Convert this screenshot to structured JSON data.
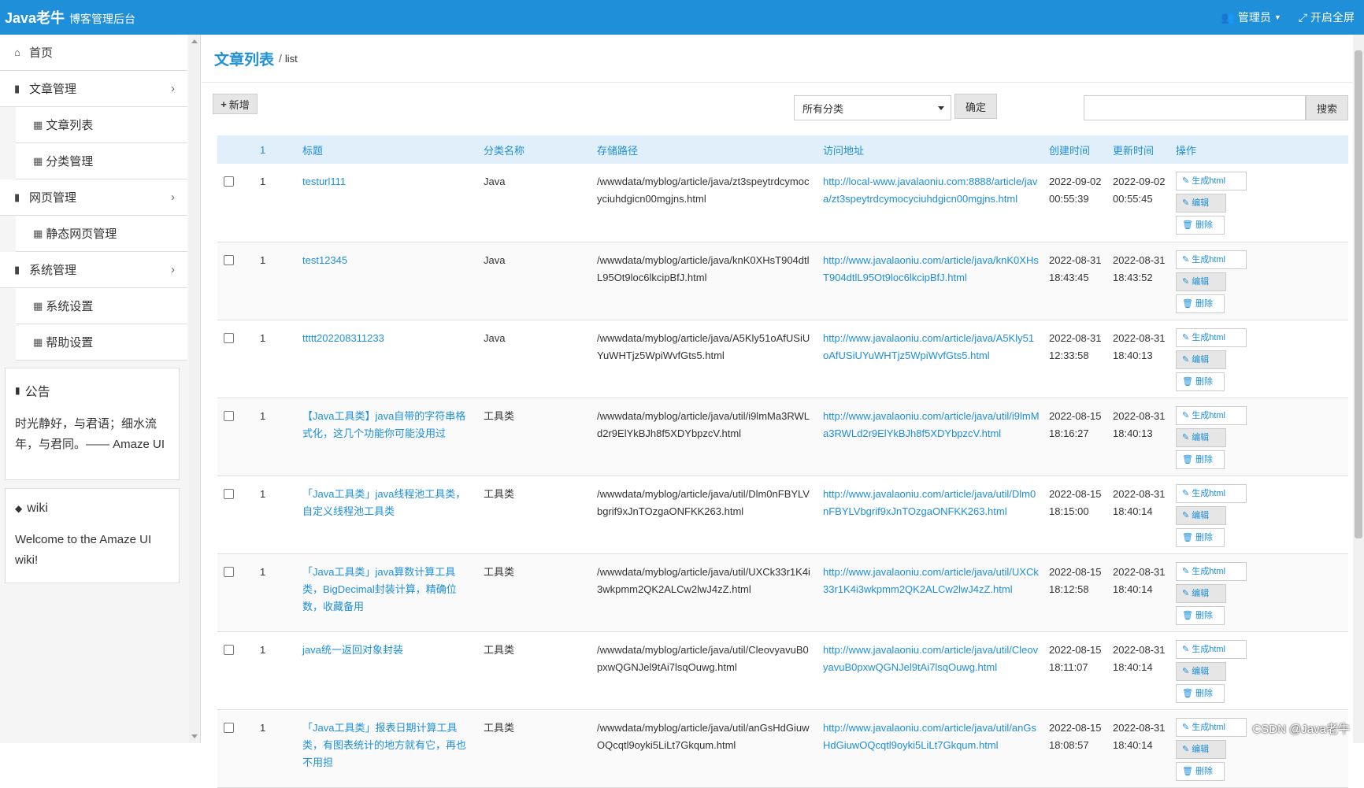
{
  "header": {
    "brand": "Java老牛",
    "subtitle": "博客管理后台",
    "admin_label": "管理员",
    "fullscreen_label": "开启全屏"
  },
  "sidebar": {
    "items": [
      {
        "label": "首页"
      },
      {
        "label": "文章管理",
        "children": [
          {
            "label": "文章列表"
          },
          {
            "label": "分类管理"
          }
        ]
      },
      {
        "label": "网页管理",
        "children": [
          {
            "label": "静态网页管理"
          }
        ]
      },
      {
        "label": "系统管理",
        "children": [
          {
            "label": "系统设置"
          },
          {
            "label": "帮助设置"
          }
        ]
      }
    ],
    "notice": {
      "title": "公告",
      "text": "时光静好，与君语；细水流年，与君同。—— Amaze UI"
    },
    "wiki": {
      "title": "wiki",
      "text": "Welcome to the Amaze UI wiki!"
    }
  },
  "breadcrumb": {
    "title": "文章列表",
    "sub": "list"
  },
  "toolbar": {
    "add_label": "新增",
    "category_selected": "所有分类",
    "confirm_label": "确定",
    "search_label": "搜索"
  },
  "table": {
    "headers": [
      "1",
      "标题",
      "分类名称",
      "存储路径",
      "访问地址",
      "创建时间",
      "更新时间",
      "操作"
    ],
    "actions": {
      "generate": "生成html",
      "edit": "编辑",
      "delete": "删除"
    },
    "rows": [
      {
        "num": "1",
        "title": "testurl111",
        "category": "Java",
        "path": "/wwwdata/myblog/article/java/zt3speytrdcymocyciuhdgicn00mgjns.html",
        "url": "http://local-www.javalaoniu.com:8888/article/java/zt3speytrdcymocyciuhdgicn00mgjns.html",
        "created_date": "2022-09-02",
        "created_time": "00:55:39",
        "updated_date": "2022-09-02",
        "updated_time": "00:55:45"
      },
      {
        "num": "1",
        "title": "test12345",
        "category": "Java",
        "path": "/wwwdata/myblog/article/java/knK0XHsT904dtlL95Ot9loc6lkcipBfJ.html",
        "url": "http://www.javalaoniu.com/article/java/knK0XHsT904dtlL95Ot9loc6lkcipBfJ.html",
        "created_date": "2022-08-31",
        "created_time": "18:43:45",
        "updated_date": "2022-08-31",
        "updated_time": "18:43:52"
      },
      {
        "num": "1",
        "title": "ttttt202208311233",
        "category": "Java",
        "path": "/wwwdata/myblog/article/java/A5Kly51oAfUSiUYuWHTjz5WpiWvfGts5.html",
        "url": "http://www.javalaoniu.com/article/java/A5Kly51oAfUSiUYuWHTjz5WpiWvfGts5.html",
        "created_date": "2022-08-31",
        "created_time": "12:33:58",
        "updated_date": "2022-08-31",
        "updated_time": "18:40:13"
      },
      {
        "num": "1",
        "title": "【Java工具类】java自带的字符串格式化，这几个功能你可能没用过",
        "category": "工具类",
        "path": "/wwwdata/myblog/article/java/util/i9lmMa3RWLd2r9ElYkBJh8f5XDYbpzcV.html",
        "url": "http://www.javalaoniu.com/article/java/util/i9lmMa3RWLd2r9ElYkBJh8f5XDYbpzcV.html",
        "created_date": "2022-08-15",
        "created_time": "18:16:27",
        "updated_date": "2022-08-31",
        "updated_time": "18:40:13"
      },
      {
        "num": "1",
        "title": "「Java工具类」java线程池工具类，自定义线程池工具类",
        "category": "工具类",
        "path": "/wwwdata/myblog/article/java/util/Dlm0nFBYLVbgrif9xJnTOzgaONFKK263.html",
        "url": "http://www.javalaoniu.com/article/java/util/Dlm0nFBYLVbgrif9xJnTOzgaONFKK263.html",
        "created_date": "2022-08-15",
        "created_time": "18:15:00",
        "updated_date": "2022-08-31",
        "updated_time": "18:40:14"
      },
      {
        "num": "1",
        "title": "「Java工具类」java算数计算工具类，BigDecimal封装计算，精确位数，收藏备用",
        "category": "工具类",
        "path": "/wwwdata/myblog/article/java/util/UXCk33r1K4i3wkpmm2QK2ALCw2lwJ4zZ.html",
        "url": "http://www.javalaoniu.com/article/java/util/UXCk33r1K4i3wkpmm2QK2ALCw2lwJ4zZ.html",
        "created_date": "2022-08-15",
        "created_time": "18:12:58",
        "updated_date": "2022-08-31",
        "updated_time": "18:40:14"
      },
      {
        "num": "1",
        "title": "java统一返回对象封装",
        "category": "工具类",
        "path": "/wwwdata/myblog/article/java/util/CleovyavuB0pxwQGNJel9tAi7lsqOuwg.html",
        "url": "http://www.javalaoniu.com/article/java/util/CleovyavuB0pxwQGNJel9tAi7lsqOuwg.html",
        "created_date": "2022-08-15",
        "created_time": "18:11:07",
        "updated_date": "2022-08-31",
        "updated_time": "18:40:14"
      },
      {
        "num": "1",
        "title": "「Java工具类」报表日期计算工具类，有图表统计的地方就有它，再也不用担",
        "category": "工具类",
        "path": "/wwwdata/myblog/article/java/util/anGsHdGiuwOQcqtl9oyki5LiLt7Gkqum.html",
        "url": "http://www.javalaoniu.com/article/java/util/anGsHdGiuwOQcqtl9oyki5LiLt7Gkqum.html",
        "created_date": "2022-08-15",
        "created_time": "18:08:57",
        "updated_date": "2022-08-31",
        "updated_time": "18:40:14"
      }
    ]
  },
  "watermark": "CSDN @Java老牛"
}
